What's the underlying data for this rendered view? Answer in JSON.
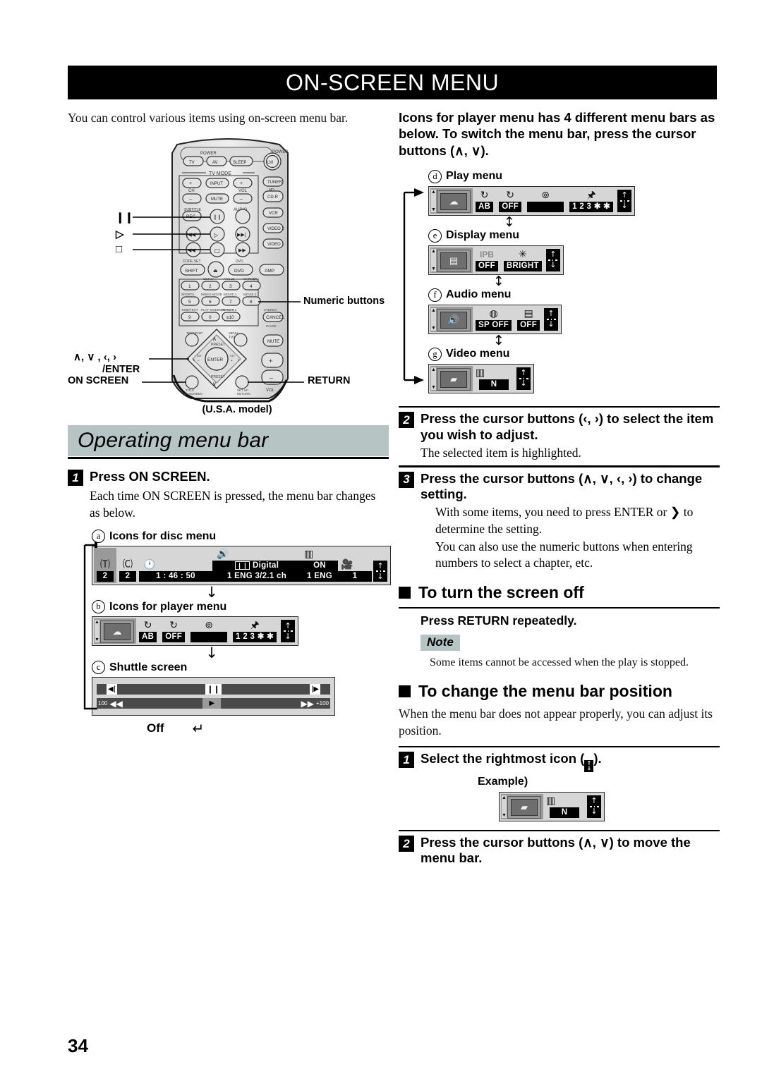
{
  "page": {
    "title": "ON-SCREEN MENU",
    "number": "34"
  },
  "left": {
    "intro": "You can control various items using on-screen menu bar.",
    "remote": {
      "callouts": {
        "pause": "❙❙",
        "play": "▷",
        "stop": "□",
        "numeric": "Numeric buttons",
        "cursor": "∧, ∨ , ‹, ›",
        "enter": "/ENTER",
        "on_screen": "ON SCREEN",
        "return": "RETURN"
      },
      "model_caption": "(U.S.A. model)"
    },
    "section_title": "Operating menu bar",
    "step1": {
      "num": "1",
      "title": "Press ON SCREEN.",
      "body": "Each time ON SCREEN is pressed, the menu bar changes as below."
    },
    "diagram": {
      "a": {
        "letter": "a",
        "label": "Icons for disc menu",
        "cells": [
          {
            "icon": "title-icon",
            "glyph": "🄣",
            "value": "2",
            "selected": true
          },
          {
            "icon": "chapter-icon",
            "glyph": "🄒",
            "value": "2",
            "selected": false
          },
          {
            "icon": "time-icon",
            "glyph": "🕐",
            "value": "1 : 46 : 50",
            "selected": false
          },
          {
            "icon": "audio-icon",
            "glyph": "🔊",
            "value_line1": "Digital",
            "value_line2": "1 ENG  3/2.1 ch",
            "selected": false
          },
          {
            "icon": "subtitle-icon",
            "glyph": "▥",
            "value_line1": "ON",
            "value_line2": "1 ENG",
            "selected": false
          },
          {
            "icon": "angle-icon",
            "glyph": "🎥",
            "value": "1",
            "selected": false
          },
          {
            "icon": "position-icon",
            "glyph": "position",
            "value": "",
            "selected": false
          }
        ]
      },
      "b": {
        "letter": "b",
        "label": "Icons for player menu",
        "cells": [
          {
            "icon": "player-thumb-icon",
            "value": "",
            "selected": true
          },
          {
            "icon": "ab-repeat-icon",
            "glyph": "↻",
            "value": "AB",
            "selected": false
          },
          {
            "icon": "repeat-icon",
            "glyph": "↻",
            "value": "OFF",
            "selected": false
          },
          {
            "icon": "search-icon",
            "glyph": "⊚",
            "value": "",
            "selected": false
          },
          {
            "icon": "marker-icon",
            "glyph": "🖈",
            "value": "1 2 3 ✱ ✱",
            "selected": false
          },
          {
            "icon": "position-icon",
            "glyph": "position",
            "value": "",
            "selected": false
          }
        ]
      },
      "c": {
        "letter": "c",
        "label": "Shuttle screen",
        "row1": {
          "left_mark": "◀|",
          "right_mark": "|▶",
          "center_mark": "❙❙"
        },
        "row2": {
          "left_num": "100",
          "left_mark": "◀◀",
          "center_mark": "▶",
          "right_mark": "▶▶",
          "right_num": "+100"
        }
      },
      "off_label": "Off",
      "loop_arrow": "↵"
    }
  },
  "right": {
    "intro_bold": "Icons for player menu has 4 different menu bars as below. To switch the menu bar, press the cursor buttons (∧, ∨).",
    "menus": [
      {
        "letter": "d",
        "label": "Play menu",
        "cells": [
          {
            "icon": "player-thumb-icon",
            "value": "",
            "selected": true
          },
          {
            "icon": "ab-repeat-icon",
            "glyph": "↻",
            "value": "AB"
          },
          {
            "icon": "repeat-icon",
            "glyph": "↻",
            "value": "OFF"
          },
          {
            "icon": "search-icon",
            "glyph": "⊚",
            "value": ""
          },
          {
            "icon": "marker-icon",
            "glyph": "🖈",
            "value": "1 2 3 ✱ ✱"
          },
          {
            "icon": "position-icon",
            "glyph": "position",
            "value": ""
          }
        ]
      },
      {
        "letter": "e",
        "label": "Display menu",
        "cells": [
          {
            "icon": "display-thumb-icon",
            "value": "",
            "selected": true
          },
          {
            "icon": "ipb-icon",
            "glyph": "IPB",
            "value": "OFF"
          },
          {
            "icon": "brightness-icon",
            "glyph": "✳",
            "value": "BRIGHT"
          },
          {
            "icon": "position-icon",
            "glyph": "position",
            "value": ""
          }
        ]
      },
      {
        "letter": "f",
        "label": "Audio menu",
        "cells": [
          {
            "icon": "audio-thumb-icon",
            "value": "",
            "selected": true
          },
          {
            "icon": "virtual-surround-icon",
            "glyph": "◍",
            "value": "SP OFF"
          },
          {
            "icon": "cinema-eq-icon",
            "glyph": "▤",
            "value": "OFF"
          },
          {
            "icon": "position-icon",
            "glyph": "position",
            "value": ""
          }
        ]
      },
      {
        "letter": "g",
        "label": "Video menu",
        "cells": [
          {
            "icon": "video-thumb-icon",
            "value": "",
            "selected": true
          },
          {
            "icon": "picture-mode-icon",
            "glyph": "▥",
            "value": "N"
          },
          {
            "icon": "position-icon",
            "glyph": "position",
            "value": ""
          }
        ]
      }
    ],
    "step2": {
      "num": "2",
      "title": "Press the cursor buttons (‹, ›) to select the item you wish to adjust.",
      "body": "The selected item is highlighted."
    },
    "step3": {
      "num": "3",
      "title": "Press the cursor buttons (∧, ∨, ‹, ›) to change setting.",
      "body1": "With some items, you need to press ENTER or ❯ to determine the setting.",
      "body2": "You can also use the numeric buttons when entering numbers to select a chapter, etc."
    },
    "turn_off": {
      "heading": "To turn the screen off",
      "instruction": "Press RETURN repeatedly.",
      "note_label": "Note",
      "note_text": "Some items cannot be accessed when the play is stopped."
    },
    "change_position": {
      "heading": "To change the menu bar position",
      "body": "When the menu bar does not appear properly, you can adjust its position.",
      "step1": {
        "num": "1",
        "title_before": "Select the rightmost icon (",
        "title_after": ").",
        "example_label": "Example)",
        "example_cells": [
          {
            "icon": "video-thumb-icon",
            "value": "",
            "selected": true
          },
          {
            "icon": "picture-mode-icon",
            "glyph": "▥",
            "value": "N"
          },
          {
            "icon": "position-icon",
            "glyph": "position",
            "value": ""
          }
        ]
      },
      "step2": {
        "num": "2",
        "title": "Press the cursor buttons (∧, ∨) to move the menu bar."
      }
    }
  },
  "colors": {
    "accent_gray": "#b6c4c4",
    "bar_bg": "#d6d6d6",
    "selected": "#9a9a9a",
    "value_bg": "#000000"
  }
}
